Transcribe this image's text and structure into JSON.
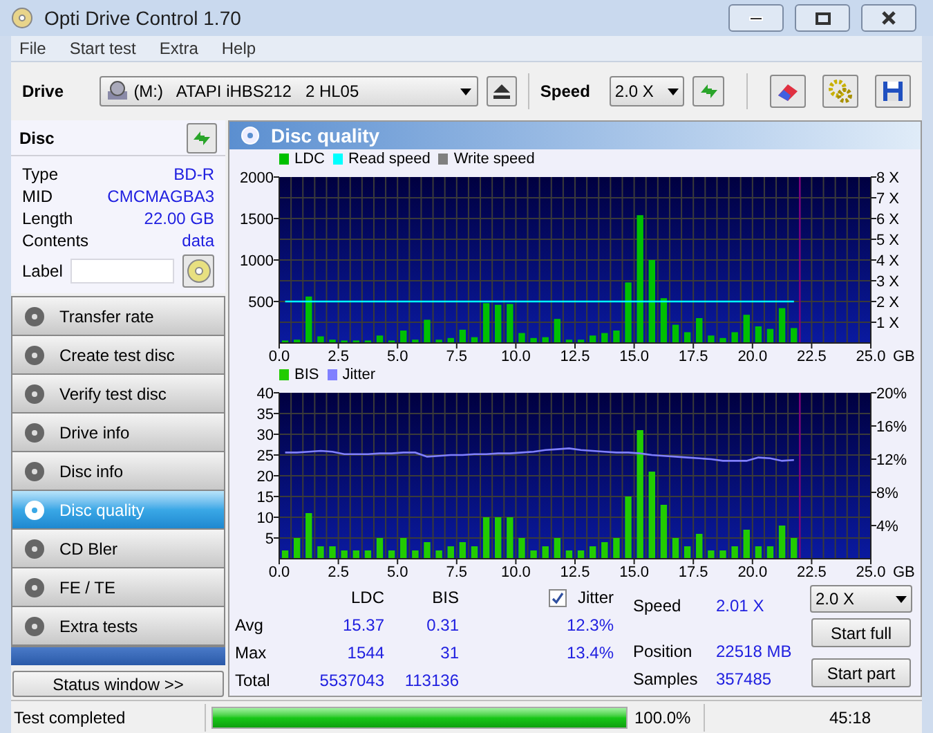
{
  "window": {
    "title": "Opti Drive Control 1.70"
  },
  "menu": [
    "File",
    "Start test",
    "Extra",
    "Help"
  ],
  "toolbar": {
    "drive_label": "Drive",
    "drive": "(M:)   ATAPI iHBS212   2 HL05",
    "speed_label": "Speed",
    "speed": "2.0 X"
  },
  "disc": {
    "title": "Disc",
    "fields": [
      {
        "label": "Type",
        "value": "BD-R"
      },
      {
        "label": "MID",
        "value": "CMCMAGBA3"
      },
      {
        "label": "Length",
        "value": "22.00 GB"
      },
      {
        "label": "Contents",
        "value": "data"
      }
    ],
    "label_field": {
      "label": "Label"
    }
  },
  "nav": [
    {
      "label": "Transfer rate",
      "selected": false
    },
    {
      "label": "Create test disc",
      "selected": false
    },
    {
      "label": "Verify test disc",
      "selected": false
    },
    {
      "label": "Drive info",
      "selected": false
    },
    {
      "label": "Disc info",
      "selected": false
    },
    {
      "label": "Disc quality",
      "selected": true
    },
    {
      "label": "CD Bler",
      "selected": false
    },
    {
      "label": "FE / TE",
      "selected": false
    },
    {
      "label": "Extra tests",
      "selected": false
    }
  ],
  "status_window_button": "Status window >>",
  "panel_title": "Disc quality",
  "charts": [
    {
      "chart_data": {
        "type": "bar",
        "grid": true,
        "legend": true,
        "ref_lines": [
          {
            "axis": "x",
            "value": 22,
            "color": "#800080"
          }
        ],
        "xlabel": "GB",
        "xlim": [
          0,
          25
        ],
        "ylim": [
          0,
          2000
        ],
        "xticks": [
          {
            "value": 0,
            "label": "0.0"
          },
          {
            "value": 2.5,
            "label": "2.5"
          },
          {
            "value": 5,
            "label": "5.0"
          },
          {
            "value": 7.5,
            "label": "7.5"
          },
          {
            "value": 10,
            "label": "10.0"
          },
          {
            "value": 12.5,
            "label": "12.5"
          },
          {
            "value": 15,
            "label": "15.0"
          },
          {
            "value": 17.5,
            "label": "17.5"
          },
          {
            "value": 20,
            "label": "20.0"
          },
          {
            "value": 22.5,
            "label": "22.5"
          },
          {
            "value": 25,
            "label": "25.0"
          }
        ],
        "yticks": [
          500,
          1000,
          1500,
          2000
        ],
        "y2lim": [
          0,
          8
        ],
        "y2ticks": [
          {
            "value": 1,
            "label": "1 X"
          },
          {
            "value": 2,
            "label": "2 X"
          },
          {
            "value": 3,
            "label": "3 X"
          },
          {
            "value": 4,
            "label": "4 X"
          },
          {
            "value": 5,
            "label": "5 X"
          },
          {
            "value": 6,
            "label": "6 X"
          },
          {
            "value": 7,
            "label": "7 X"
          },
          {
            "value": 8,
            "label": "8 X"
          }
        ],
        "x": [
          0.25,
          0.75,
          1.25,
          1.75,
          2.25,
          2.75,
          3.25,
          3.75,
          4.25,
          4.75,
          5.25,
          5.75,
          6.25,
          6.75,
          7.25,
          7.75,
          8.25,
          8.75,
          9.25,
          9.75,
          10.25,
          10.75,
          11.25,
          11.75,
          12.25,
          12.75,
          13.25,
          13.75,
          14.25,
          14.75,
          15.25,
          15.75,
          16.25,
          16.75,
          17.25,
          17.75,
          18.25,
          18.75,
          19.25,
          19.75,
          20.25,
          20.75,
          21.25,
          21.75
        ],
        "series": [
          {
            "name": "LDC",
            "color": "#00c000",
            "values": [
              30,
              40,
              560,
              80,
              40,
              30,
              30,
              30,
              90,
              30,
              150,
              40,
              280,
              40,
              60,
              160,
              70,
              480,
              460,
              470,
              120,
              60,
              70,
              290,
              40,
              40,
              90,
              120,
              150,
              730,
              1540,
              1000,
              540,
              220,
              130,
              300,
              90,
              60,
              130,
              340,
              200,
              170,
              420,
              180
            ]
          },
          {
            "name": "Read speed",
            "color": "#00ffff",
            "type": "line",
            "axis": "y2",
            "values": [
              2,
              2,
              2,
              2,
              2,
              2,
              2,
              2,
              2,
              2,
              2,
              2,
              2,
              2,
              2,
              2,
              2,
              2,
              2,
              2,
              2,
              2,
              2,
              2,
              2,
              2,
              2,
              2,
              2,
              2,
              2,
              2,
              2,
              2,
              2,
              2,
              2,
              2,
              2,
              2,
              2,
              2,
              2,
              2
            ]
          },
          {
            "name": "Write speed",
            "color": "#808080",
            "type": "line",
            "axis": "y2",
            "values": [
              null,
              null,
              null,
              null,
              null,
              null,
              null,
              null,
              null,
              null,
              null,
              null,
              null,
              null,
              null,
              null,
              null,
              null,
              null,
              null,
              null,
              null,
              null,
              null,
              null,
              null,
              null,
              null,
              null,
              null,
              null,
              null,
              null,
              null,
              null,
              null,
              null,
              null,
              null,
              null,
              null,
              null,
              null,
              null
            ]
          }
        ]
      }
    },
    {
      "chart_data": {
        "type": "bar",
        "grid": true,
        "legend": true,
        "ref_lines": [
          {
            "axis": "x",
            "value": 22,
            "color": "#800080"
          }
        ],
        "xlabel": "GB",
        "xlim": [
          0,
          25
        ],
        "ylim": [
          0,
          40
        ],
        "xticks": [
          {
            "value": 0,
            "label": "0.0"
          },
          {
            "value": 2.5,
            "label": "2.5"
          },
          {
            "value": 5,
            "label": "5.0"
          },
          {
            "value": 7.5,
            "label": "7.5"
          },
          {
            "value": 10,
            "label": "10.0"
          },
          {
            "value": 12.5,
            "label": "12.5"
          },
          {
            "value": 15,
            "label": "15.0"
          },
          {
            "value": 17.5,
            "label": "17.5"
          },
          {
            "value": 20,
            "label": "20.0"
          },
          {
            "value": 22.5,
            "label": "22.5"
          },
          {
            "value": 25,
            "label": "25.0"
          }
        ],
        "yticks": [
          5,
          10,
          15,
          20,
          25,
          30,
          35,
          40
        ],
        "y2lim": [
          0,
          20
        ],
        "y2ticks": [
          {
            "value": 4,
            "label": "4%"
          },
          {
            "value": 8,
            "label": "8%"
          },
          {
            "value": 12,
            "label": "12%"
          },
          {
            "value": 16,
            "label": "16%"
          },
          {
            "value": 20,
            "label": "20%"
          }
        ],
        "x": [
          0.25,
          0.75,
          1.25,
          1.75,
          2.25,
          2.75,
          3.25,
          3.75,
          4.25,
          4.75,
          5.25,
          5.75,
          6.25,
          6.75,
          7.25,
          7.75,
          8.25,
          8.75,
          9.25,
          9.75,
          10.25,
          10.75,
          11.25,
          11.75,
          12.25,
          12.75,
          13.25,
          13.75,
          14.25,
          14.75,
          15.25,
          15.75,
          16.25,
          16.75,
          17.25,
          17.75,
          18.25,
          18.75,
          19.25,
          19.75,
          20.25,
          20.75,
          21.25,
          21.75
        ],
        "series": [
          {
            "name": "BIS",
            "color": "#22cc00",
            "values": [
              2,
              5,
              11,
              3,
              3,
              2,
              2,
              2,
              5,
              2,
              5,
              2,
              4,
              2,
              3,
              4,
              3,
              10,
              10,
              10,
              5,
              2,
              3,
              5,
              2,
              2,
              3,
              4,
              5,
              15,
              31,
              21,
              13,
              5,
              3,
              6,
              2,
              2,
              3,
              7,
              3,
              3,
              8,
              5
            ]
          },
          {
            "name": "Jitter",
            "color": "#8080ff",
            "type": "line",
            "axis": "y2",
            "values": [
              12.8,
              12.8,
              12.9,
              13.0,
              12.9,
              12.6,
              12.6,
              12.6,
              12.7,
              12.7,
              12.8,
              12.8,
              12.3,
              12.4,
              12.5,
              12.5,
              12.6,
              12.6,
              12.7,
              12.7,
              12.8,
              12.9,
              13.1,
              13.2,
              13.3,
              13.1,
              13.0,
              12.9,
              12.8,
              12.8,
              12.7,
              12.5,
              12.4,
              12.3,
              12.2,
              12.1,
              12.0,
              11.8,
              11.8,
              11.8,
              12.2,
              12.1,
              11.8,
              11.9
            ]
          }
        ]
      }
    }
  ],
  "stats": {
    "columns": [
      "LDC",
      "BIS"
    ],
    "jitter": {
      "label": "Jitter",
      "checked": true
    },
    "rows": [
      {
        "label": "Avg",
        "ldc": "15.37",
        "bis": "0.31",
        "jitter": "12.3%"
      },
      {
        "label": "Max",
        "ldc": "1544",
        "bis": "31",
        "jitter": "13.4%"
      },
      {
        "label": "Total",
        "ldc": "5537043",
        "bis": "113136"
      }
    ]
  },
  "info": [
    {
      "label": "Speed",
      "value": "2.01 X"
    },
    {
      "label": "Position",
      "value": "22518 MB"
    },
    {
      "label": "Samples",
      "value": "357485"
    }
  ],
  "controls": {
    "speed": "2.0 X",
    "buttons": [
      "Start full",
      "Start part"
    ]
  },
  "status_bar": {
    "text": "Test completed",
    "progress": {
      "level": 1
    },
    "percent": "100.0%",
    "time": "45:18"
  }
}
